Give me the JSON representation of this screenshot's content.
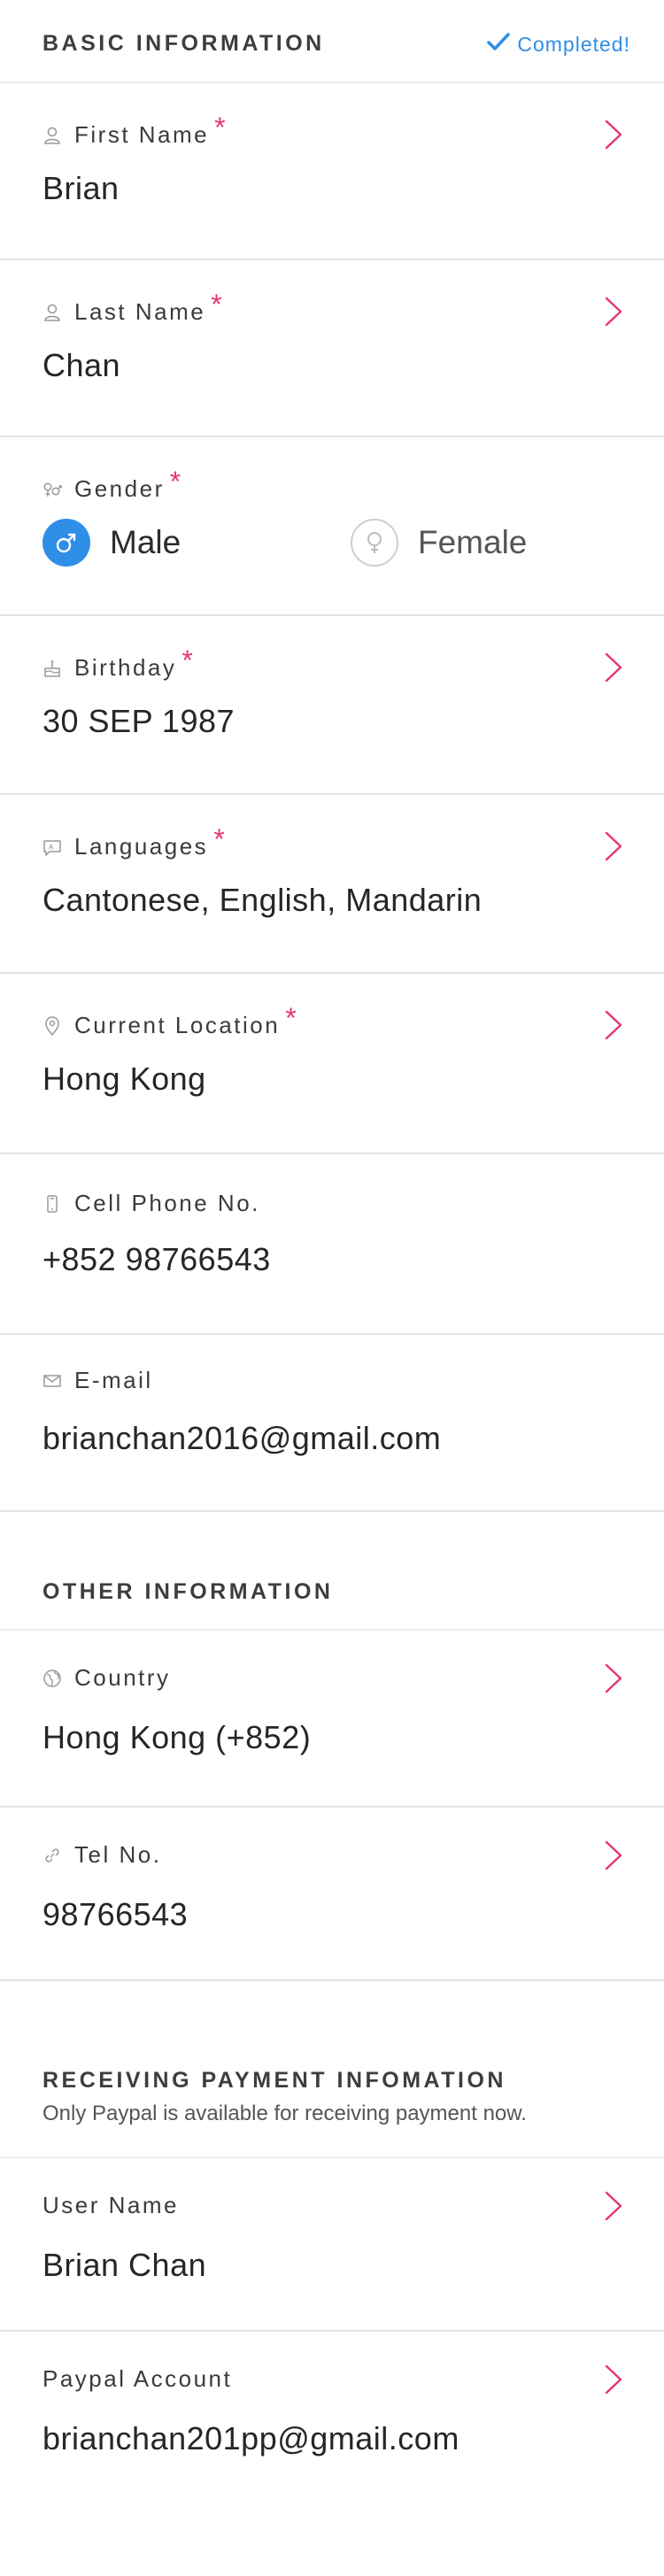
{
  "colors": {
    "accent": "#2f8ee6",
    "required": "#e8366a",
    "chevron": "#e8366a"
  },
  "basic": {
    "title": "BASIC INFORMATION",
    "status": "Completed!",
    "first_name": {
      "label": "First Name",
      "value": "Brian",
      "icon": "person-icon",
      "required": "*"
    },
    "last_name": {
      "label": "Last Name",
      "value": "Chan",
      "icon": "person-icon",
      "required": "*"
    },
    "gender": {
      "label": "Gender",
      "icon": "gender-icon",
      "required": "*",
      "options": [
        "Male",
        "Female"
      ],
      "selected": "Male"
    },
    "birthday": {
      "label": "Birthday",
      "value": "30 SEP 1987",
      "icon": "cake-icon",
      "required": "*"
    },
    "languages": {
      "label": "Languages",
      "value": "Cantonese, English, Mandarin",
      "icon": "speech-bubble-icon",
      "required": "*"
    },
    "location": {
      "label": "Current Location",
      "value": "Hong Kong",
      "icon": "map-pin-icon",
      "required": "*"
    },
    "cell_phone": {
      "label": "Cell Phone No.",
      "value": "+852 98766543",
      "icon": "mobile-phone-icon"
    },
    "email": {
      "label": "E-mail",
      "value": "brianchan2016@gmail.com",
      "icon": "envelope-icon"
    }
  },
  "other": {
    "title": "OTHER INFORMATION",
    "country": {
      "label": "Country",
      "value": "Hong Kong (+852)",
      "icon": "globe-icon"
    },
    "tel": {
      "label": "Tel No.",
      "value": "98766543",
      "icon": "link-icon"
    }
  },
  "payment": {
    "title": "RECEIVING PAYMENT INFOMATION",
    "subtitle": "Only Paypal is available for receiving payment now.",
    "user_name": {
      "label": "User Name",
      "value": "Brian Chan"
    },
    "paypal": {
      "label": "Paypal Account",
      "value": "brianchan201pp@gmail.com"
    }
  }
}
